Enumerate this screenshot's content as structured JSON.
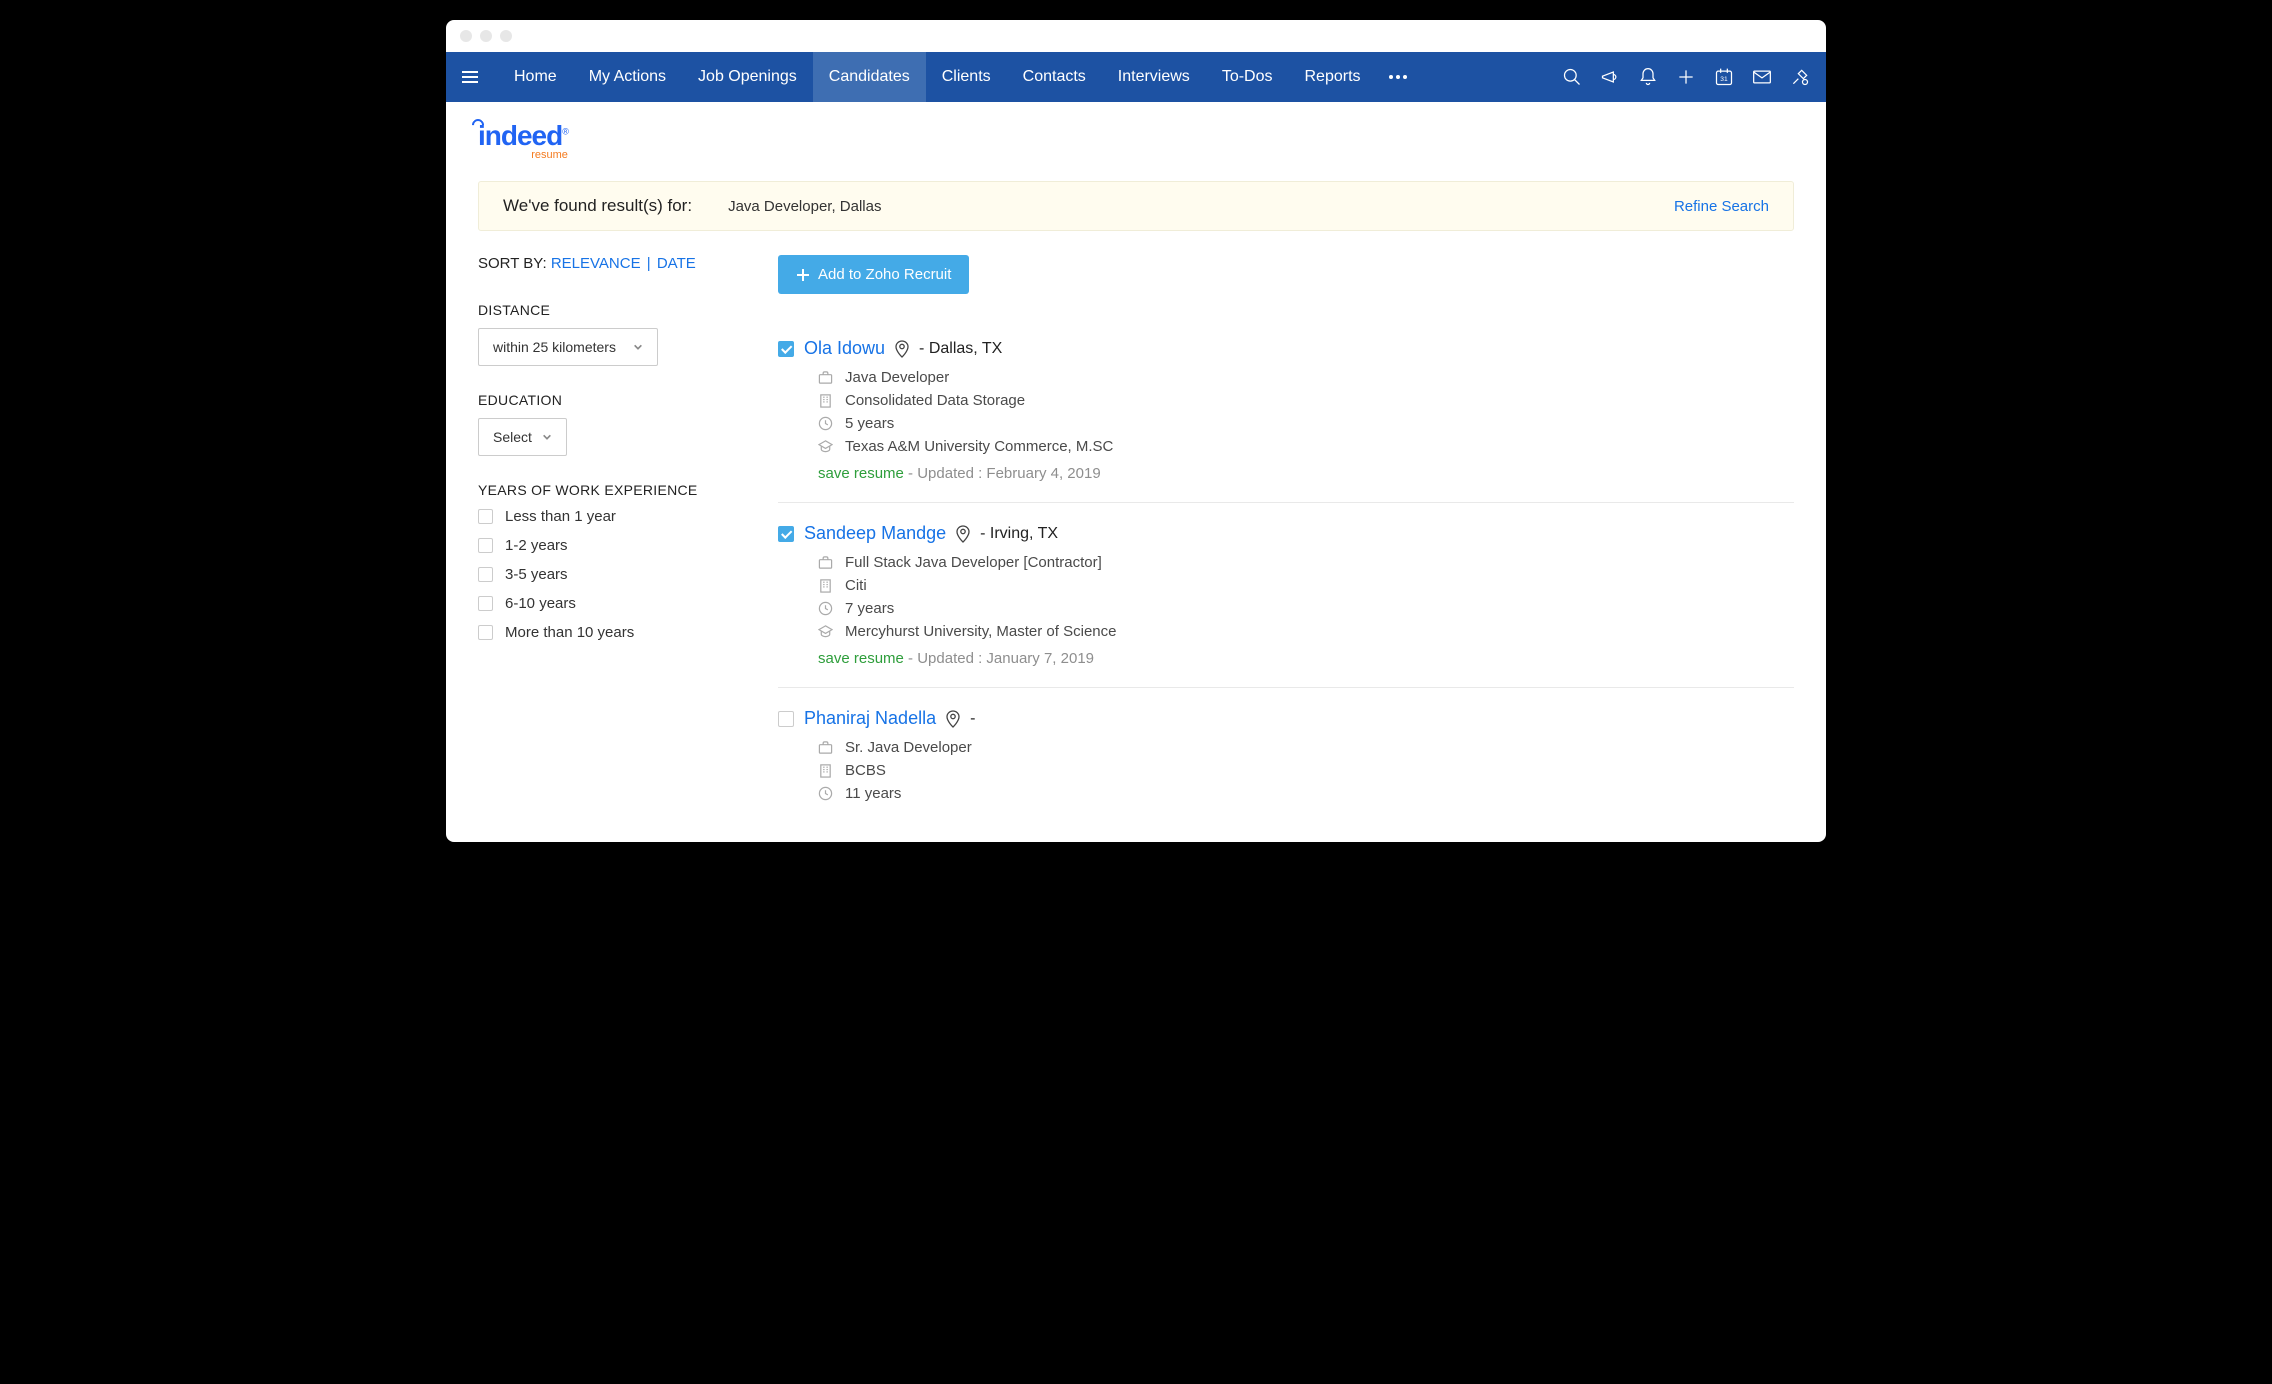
{
  "nav": {
    "items": [
      "Home",
      "My Actions",
      "Job Openings",
      "Candidates",
      "Clients",
      "Contacts",
      "Interviews",
      "To-Dos",
      "Reports"
    ],
    "active_index": 3
  },
  "results_bar": {
    "text": "We've found result(s) for:",
    "query": "Java Developer, Dallas",
    "refine": "Refine Search"
  },
  "sort": {
    "label": "SORT BY:",
    "opt1": "RELEVANCE",
    "opt2": "DATE"
  },
  "filters": {
    "distance": {
      "label": "DISTANCE",
      "value": "within 25 kilometers"
    },
    "education": {
      "label": "EDUCATION",
      "value": "Select"
    },
    "exp": {
      "label": "YEARS OF WORK EXPERIENCE",
      "options": [
        "Less than 1 year",
        "1-2 years",
        "3-5 years",
        "6-10 years",
        "More than 10 years"
      ]
    }
  },
  "add_button": "Add to Zoho Recruit",
  "candidates": [
    {
      "checked": true,
      "name": "Ola Idowu",
      "location": "- Dallas, TX",
      "title": "Java Developer",
      "company": "Consolidated Data Storage",
      "years": "5 years",
      "education": "Texas A&M University Commerce, M.SC",
      "save": "save resume",
      "updated": " - Updated : February 4, 2019"
    },
    {
      "checked": true,
      "name": "Sandeep Mandge",
      "location": "- Irving, TX",
      "title": "Full Stack Java Developer [Contractor]",
      "company": "Citi",
      "years": "7 years",
      "education": "Mercyhurst University, Master of Science",
      "save": "save resume",
      "updated": " - Updated : January 7, 2019"
    },
    {
      "checked": false,
      "name": "Phaniraj Nadella",
      "location": "-",
      "title": "Sr. Java Developer",
      "company": "BCBS",
      "years": "11 years",
      "education": "",
      "save": "",
      "updated": ""
    }
  ]
}
